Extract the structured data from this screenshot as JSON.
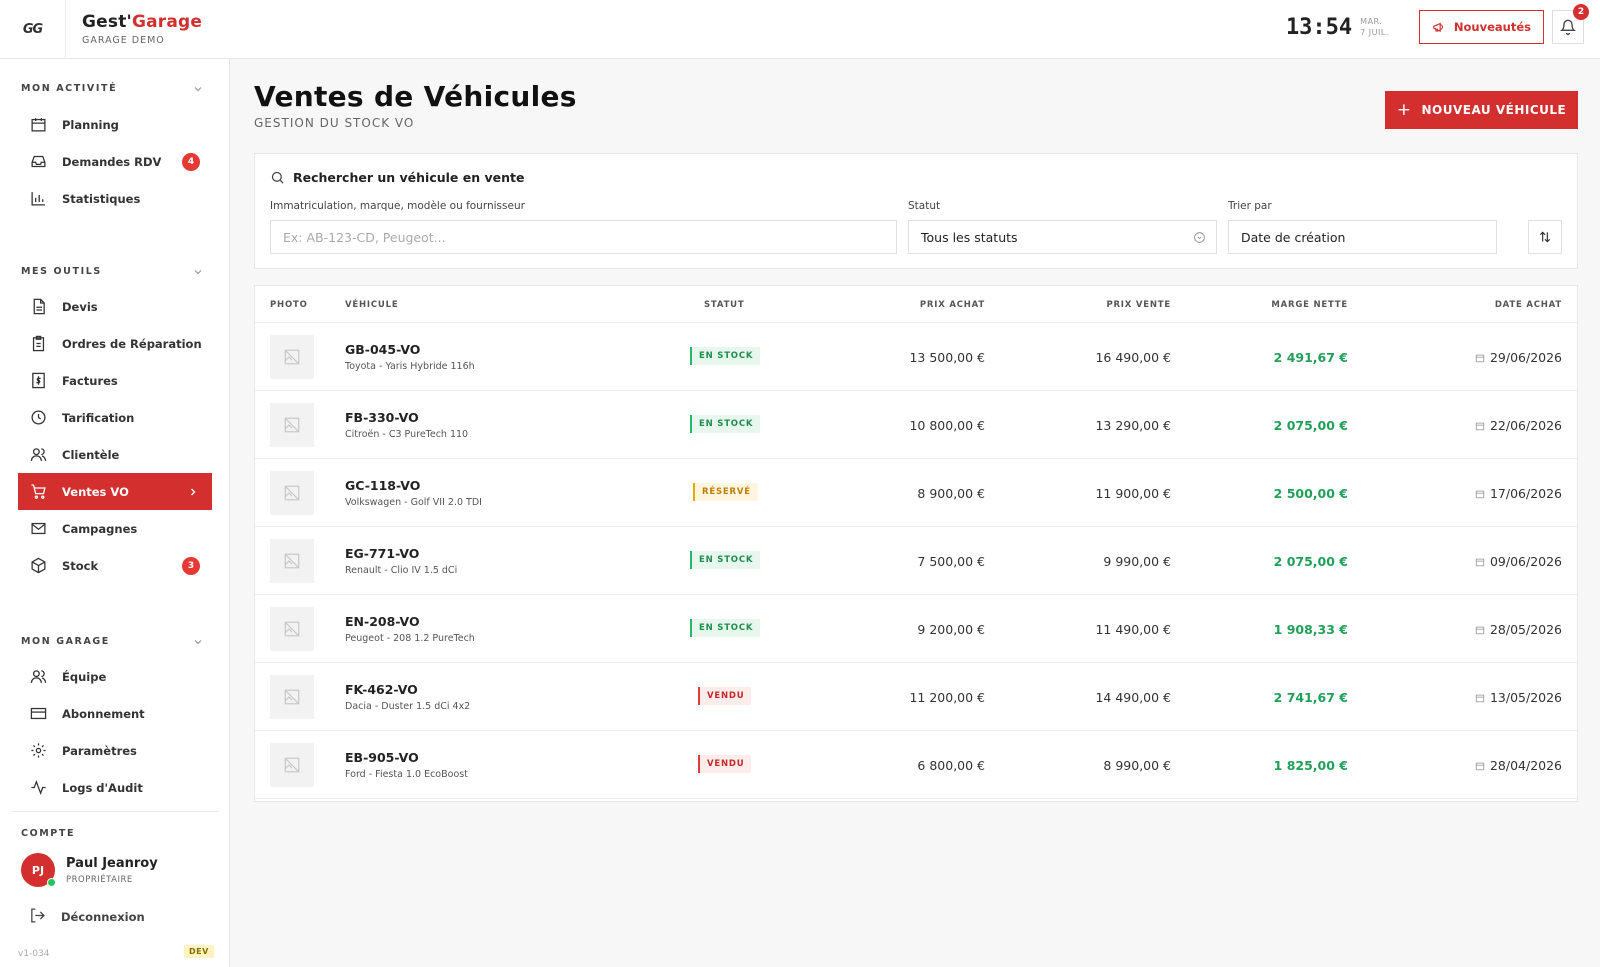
{
  "header": {
    "logo_text": "GG",
    "brand_a": "Gest'",
    "brand_b": "Garage",
    "garage_name": "GARAGE DEMO",
    "time": "13:54",
    "day": "MAR.",
    "date": "7 JUIL.",
    "news_label": "Nouveautés",
    "notif_count": "2"
  },
  "sidebar": {
    "sections": {
      "activity": "MON ACTIVITÉ",
      "tools": "MES OUTILS",
      "garage": "MON GARAGE",
      "account": "COMPTE"
    },
    "items": {
      "planning": "Planning",
      "demandes": "Demandes RDV",
      "demandes_badge": "4",
      "stats": "Statistiques",
      "devis": "Devis",
      "ordres": "Ordres de Réparation",
      "factures": "Factures",
      "tarif": "Tarification",
      "clientele": "Clientèle",
      "ventes": "Ventes VO",
      "campagnes": "Campagnes",
      "stock": "Stock",
      "stock_badge": "3",
      "equipe": "Équipe",
      "abonnement": "Abonnement",
      "parametres": "Paramètres",
      "logs": "Logs d'Audit"
    },
    "user": {
      "initials": "PJ",
      "name": "Paul Jeanroy",
      "role": "PROPRIÉTAIRE"
    },
    "logout": "Déconnexion",
    "version": "v1-034",
    "env": "DEV"
  },
  "main": {
    "title": "Ventes de Véhicules",
    "subtitle": "GESTION DU STOCK VO",
    "new_button": "NOUVEAU VÉHICULE",
    "search": {
      "heading": "Rechercher un véhicule en vente",
      "query_label": "Immatriculation, marque, modèle ou fournisseur",
      "query_placeholder": "Ex: AB-123-CD, Peugeot...",
      "status_label": "Statut",
      "status_value": "Tous les statuts",
      "sort_label": "Trier par",
      "sort_value": "Date de création"
    },
    "columns": {
      "photo": "PHOTO",
      "vehicle": "VÉHICULE",
      "status": "STATUT",
      "buy": "PRIX ACHAT",
      "sell": "PRIX VENTE",
      "margin": "MARGE NETTE",
      "date": "DATE ACHAT"
    },
    "rows": [
      {
        "plate": "GB-045-VO",
        "model": "Toyota - Yaris Hybride 116h",
        "status": "EN STOCK",
        "kind": "stock",
        "buy": "13 500,00 €",
        "sell": "16 490,00 €",
        "margin": "2 491,67 €",
        "date": "29/06/2026"
      },
      {
        "plate": "FB-330-VO",
        "model": "Citroën - C3 PureTech 110",
        "status": "EN STOCK",
        "kind": "stock",
        "buy": "10 800,00 €",
        "sell": "13 290,00 €",
        "margin": "2 075,00 €",
        "date": "22/06/2026"
      },
      {
        "plate": "GC-118-VO",
        "model": "Volkswagen - Golf VII 2.0 TDI",
        "status": "RÉSERVÉ",
        "kind": "res",
        "buy": "8 900,00 €",
        "sell": "11 900,00 €",
        "margin": "2 500,00 €",
        "date": "17/06/2026"
      },
      {
        "plate": "EG-771-VO",
        "model": "Renault - Clio IV 1.5 dCi",
        "status": "EN STOCK",
        "kind": "stock",
        "buy": "7 500,00 €",
        "sell": "9 990,00 €",
        "margin": "2 075,00 €",
        "date": "09/06/2026"
      },
      {
        "plate": "EN-208-VO",
        "model": "Peugeot - 208 1.2 PureTech",
        "status": "EN STOCK",
        "kind": "stock",
        "buy": "9 200,00 €",
        "sell": "11 490,00 €",
        "margin": "1 908,33 €",
        "date": "28/05/2026"
      },
      {
        "plate": "FK-462-VO",
        "model": "Dacia - Duster 1.5 dCi 4x2",
        "status": "VENDU",
        "kind": "sold",
        "buy": "11 200,00 €",
        "sell": "14 490,00 €",
        "margin": "2 741,67 €",
        "date": "13/05/2026"
      },
      {
        "plate": "EB-905-VO",
        "model": "Ford - Fiesta 1.0 EcoBoost",
        "status": "VENDU",
        "kind": "sold",
        "buy": "6 800,00 €",
        "sell": "8 990,00 €",
        "margin": "1 825,00 €",
        "date": "28/04/2026"
      }
    ]
  },
  "colors": {
    "accent": "#d32f2f",
    "success": "#22a05a",
    "warning": "#f0a500"
  },
  "icons": [
    "calendar-icon",
    "inbox-icon",
    "bar-chart-icon",
    "file-icon",
    "clipboard-icon",
    "dollar-icon",
    "clock-icon",
    "users-icon",
    "cart-icon",
    "mail-icon",
    "box-icon",
    "card-icon",
    "gear-icon",
    "activity-icon",
    "logout-icon",
    "search-icon",
    "bell-icon",
    "megaphone-icon",
    "sort-icon",
    "image-placeholder-icon"
  ]
}
